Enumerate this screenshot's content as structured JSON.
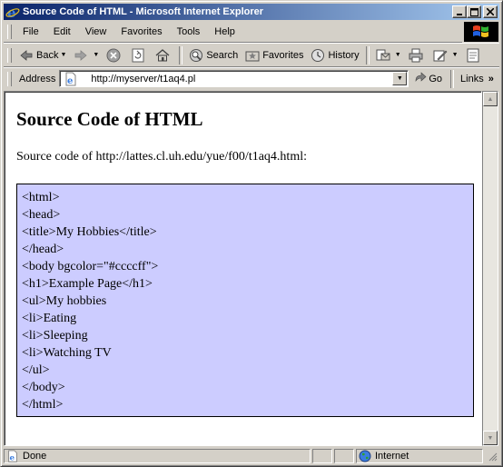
{
  "window": {
    "title": "Source Code of HTML - Microsoft Internet Explorer",
    "controls": {
      "minimize": "_",
      "maximize": "□",
      "close": "✕"
    }
  },
  "menu": {
    "items": [
      "File",
      "Edit",
      "View",
      "Favorites",
      "Tools",
      "Help"
    ]
  },
  "toolbar": {
    "back": "Back",
    "search": "Search",
    "favorites": "Favorites",
    "history": "History"
  },
  "address": {
    "label": "Address",
    "value": "http://myserver/t1aq4.pl",
    "go": "Go",
    "links": "Links"
  },
  "page": {
    "heading": "Source Code of HTML",
    "intro": "Source code of http://lattes.cl.uh.edu/yue/f00/t1aq4.html:",
    "code_bg": "#ccccff",
    "code_lines": [
      "<html>",
      "<head>",
      "<title>My Hobbies</title>",
      "</head>",
      "<body bgcolor=\"#ccccff\">",
      "<h1>Example Page</h1>",
      "<ul>My hobbies",
      "<li>Eating",
      "<li>Sleeping",
      "<li>Watching TV",
      "</ul>",
      "</body>",
      "</html>"
    ]
  },
  "status": {
    "text": "Done",
    "zone": "Internet"
  },
  "colors": {
    "titlebar_start": "#0a246a",
    "titlebar_end": "#a6caf0",
    "chrome": "#d4d0c8"
  }
}
